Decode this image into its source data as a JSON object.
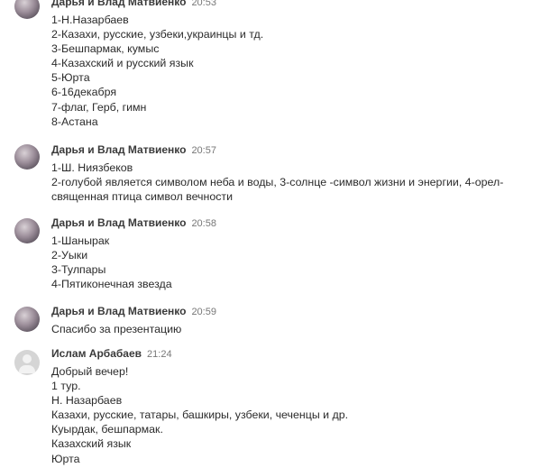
{
  "messages": [
    {
      "author": "Дарья и Влад Матвиенко",
      "time": "20:53",
      "avatar": "user-photo-avatar",
      "lines": [
        "1-Н.Назарбаев",
        "2-Казахи, русские, узбеки,украинцы и тд.",
        "3-Бешпармак, кумыс",
        "4-Казахский и русский язык",
        "5-Юрта",
        "6-16декабря",
        "7-флаг, Герб, гимн",
        "8-Астана"
      ]
    },
    {
      "author": "Дарья и Влад Матвиенко",
      "time": "20:57",
      "avatar": "user-photo-avatar",
      "lines": [
        "1-Ш. Ниязбеков",
        "2-голубой является символом неба и воды, 3-солнце -символ жизни и энергии, 4-орел-священная птица символ вечности"
      ]
    },
    {
      "author": "Дарья и Влад Матвиенко",
      "time": "20:58",
      "avatar": "user-photo-avatar",
      "lines": [
        "1-Шанырак",
        "2-Уыки",
        "3-Тулпары",
        "4-Пятиконечная звезда"
      ]
    },
    {
      "author": "Дарья и Влад Матвиенко",
      "time": "20:59",
      "avatar": "user-photo-avatar",
      "lines": [
        "Спасибо за презентацию"
      ]
    },
    {
      "author": "Ислам Арбабаев",
      "time": "21:24",
      "avatar": "default-user-avatar",
      "lines": [
        "Добрый вечер!",
        "1 тур.",
        "Н. Назарбаев",
        "Казахи, русские, татары, башкиры, узбеки, чеченцы и др.",
        "Куырдак, бешпармак.",
        "Казахский язык",
        "Юрта"
      ]
    }
  ]
}
